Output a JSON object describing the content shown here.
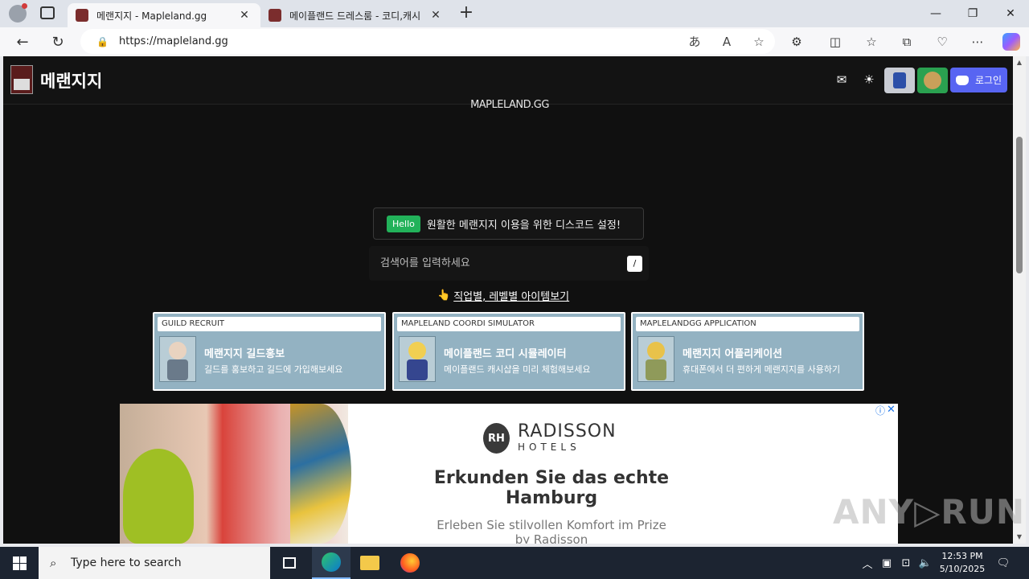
{
  "browser": {
    "tabs": [
      {
        "title": "메랜지지 - Mapleland.gg",
        "active": true
      },
      {
        "title": "메이플랜드 드레스룸 - 코디,캐시",
        "active": false
      }
    ],
    "new_tab_label": "+",
    "url": "https://mapleland.gg",
    "window_controls": {
      "minimize": "—",
      "restore": "❐",
      "close": "✕"
    }
  },
  "site": {
    "logo_text": "메랜지지",
    "brand_under_logo": "MAPLELAND.GG",
    "login_label": "로그인",
    "notice": {
      "badge": "Hello",
      "text": "원활한 메랜지지 이용을 위한 디스코드 설정!"
    },
    "search": {
      "placeholder": "검색어를 입력하세요",
      "shortcut": "/"
    },
    "jobs_link": {
      "icon": "👆",
      "text": "직업별, 레벨별 아이템보기"
    },
    "cards": [
      {
        "tag": "GUILD RECRUIT",
        "title": "메랜지지 길드홍보",
        "desc": "길드를 홍보하고 길드에 가입해보세요"
      },
      {
        "tag": "MAPLELAND COORDI SIMULATOR",
        "title": "메이플랜드 코디 시뮬레이터",
        "desc": "메이플랜드 캐시샵을 미리 체험해보세요"
      },
      {
        "tag": "MAPLELANDGG APPLICATION",
        "title": "메랜지지 어플리케이션",
        "desc": "휴대폰에서 더 편하게 메랜지지를 사용하기"
      }
    ]
  },
  "ad": {
    "brand_line1": "RADISSON",
    "brand_line2": "HOTELS",
    "brand_mark": "RH",
    "headline": "Erkunden Sie das echte Hamburg",
    "subline": "Erleben Sie stilvollen Komfort im Prize by Radisson",
    "info_icon": "ⓘ",
    "close_icon": "✕"
  },
  "watermark": "ANY▷RUN",
  "taskbar": {
    "search_placeholder": "Type here to search",
    "time": "12:53 PM",
    "date": "5/10/2025"
  },
  "colors": {
    "page_bg": "#101010",
    "card_bg": "#93b2c2",
    "discord": "#5865f2",
    "hello_badge": "#22b25a"
  }
}
